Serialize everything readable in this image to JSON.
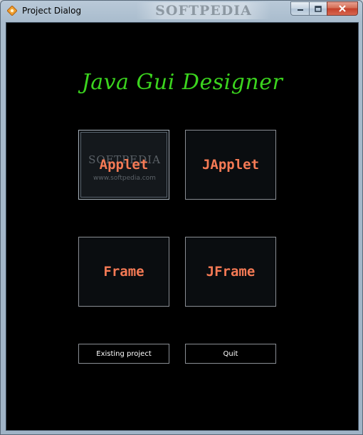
{
  "window": {
    "title": "Project Dialog",
    "watermark": "SOFTPEDIA"
  },
  "main": {
    "heading": "Java Gui Designer",
    "buttons": {
      "applet": "Applet",
      "japplet": "JApplet",
      "frame": "Frame",
      "jframe": "JFrame",
      "existing_project": "Existing project",
      "quit": "Quit"
    },
    "applet_watermark": "SOFTPEDIA",
    "applet_watermark_url": "www.softpedia.com"
  },
  "colors": {
    "heading": "#3bd41e",
    "button_label": "#f57a55",
    "client_background": "#000000"
  }
}
